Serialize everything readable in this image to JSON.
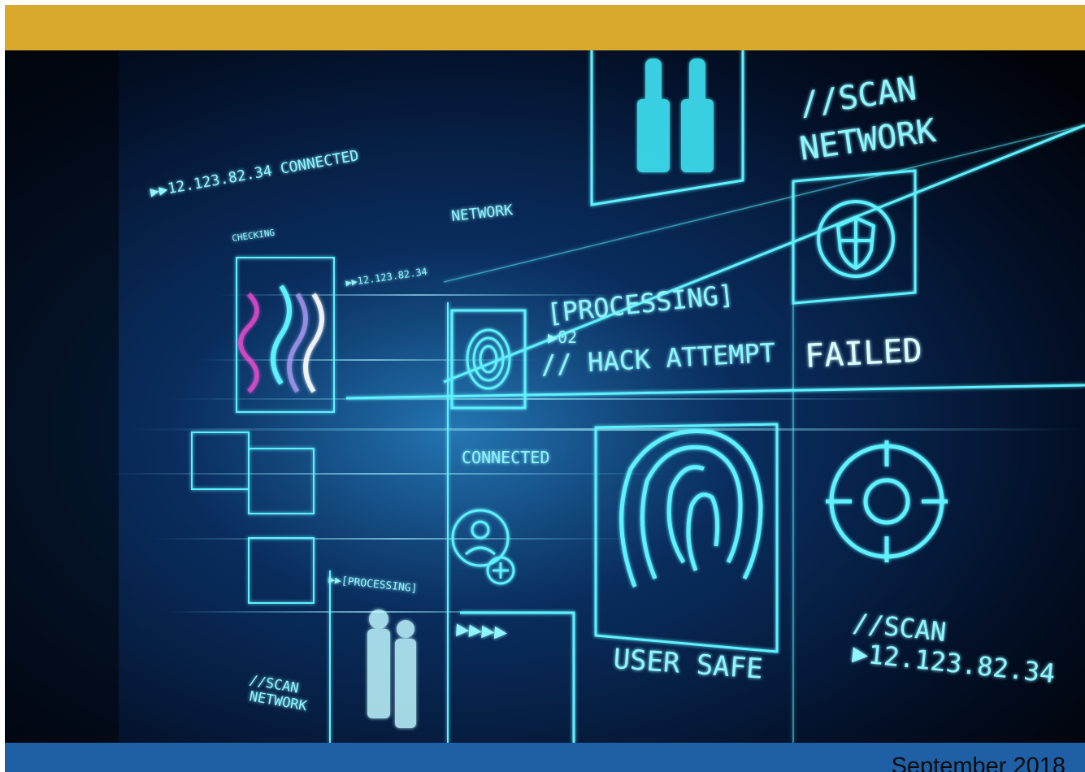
{
  "cover": {
    "date": "September 2018",
    "colors": {
      "gold_band": "#d9a92e",
      "footer_band": "#1f5fa6",
      "hud_cyan": "#5ef1ff",
      "background": "#02060f"
    },
    "hud": {
      "scan_network_top": [
        "//SCAN",
        "NETWORK"
      ],
      "processing": "[PROCESSING]",
      "code_02": "▶02",
      "hack_attempt": "// HACK ATTEMPT",
      "failed": "FAILED",
      "network": "NETWORK",
      "connected_top": "▶▶12.123.82.34 CONNECTED",
      "checking": "CHECKING",
      "ip_small": "▶▶12.123.82.34",
      "connected_mid": "CONNECTED",
      "processing_small": "▶▶[PROCESSING]",
      "user_safe": "USER SAFE",
      "scan_bottom": "//SCAN",
      "ip_bottom": "▶12.123.82.34",
      "scan_network_bottom": [
        "//SCAN",
        "NETWORK"
      ],
      "arrows": "▶▶▶▶"
    },
    "icons": [
      "shield-icon",
      "fingerprint-icon",
      "crosshair-icon",
      "add-user-icon",
      "people-icon"
    ]
  }
}
